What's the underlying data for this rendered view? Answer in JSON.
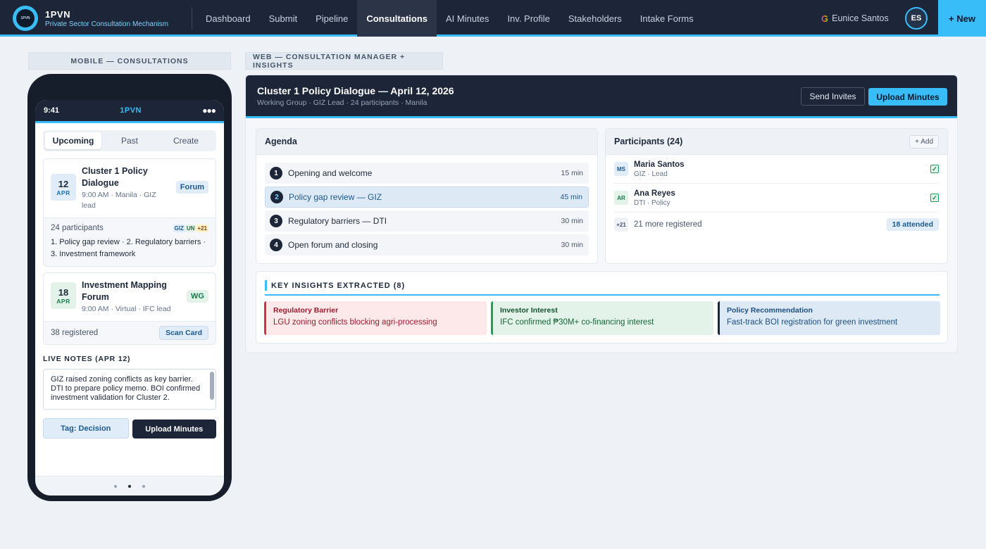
{
  "nav": {
    "logo_text": "1PVN",
    "brand_name": "1PVN",
    "brand_sub": "Private Sector Consultation Mechanism",
    "items": [
      {
        "label": "Dashboard"
      },
      {
        "label": "Submit"
      },
      {
        "label": "Pipeline"
      },
      {
        "label": "Consultations",
        "active": true
      },
      {
        "label": "AI Minutes"
      },
      {
        "label": "Inv. Profile"
      },
      {
        "label": "Stakeholders"
      },
      {
        "label": "Intake Forms"
      }
    ],
    "google_glyph": "G",
    "user_name": "Eunice Santos",
    "avatar_initials": "ES",
    "new_label": "+ New",
    "accent": "#38bdf8"
  },
  "mobile": {
    "section_label": "MOBILE — CONSULTATIONS",
    "status": {
      "time": "9:41",
      "app": "1PVN",
      "signal": "●●●"
    },
    "tabs": [
      "Upcoming",
      "Past",
      "Create"
    ],
    "events": [
      {
        "day": "12",
        "month": "APR",
        "title": "Cluster 1 Policy Dialogue",
        "meta": "9:00 AM · Manila · GIZ lead",
        "tag": "Forum",
        "count": "24 participants",
        "orgs": [
          "GIZ",
          "UN",
          "+21"
        ],
        "agenda": "1. Policy gap review · 2. Regulatory barriers · 3. Investment framework"
      },
      {
        "day": "18",
        "month": "APR",
        "title": "Investment Mapping Forum",
        "meta": "9:00 AM · Virtual · IFC lead",
        "tag": "WG",
        "count": "38 registered",
        "action": "Scan Card"
      }
    ],
    "notes_heading": "LIVE NOTES (APR 12)",
    "notes_text": "GIZ raised zoning conflicts as key barrier. DTI to prepare policy memo. BOI confirmed investment validation for Cluster 2.",
    "tag_button": "Tag: Decision",
    "upload_button": "Upload Minutes"
  },
  "web": {
    "section_label": "WEB — CONSULTATION MANAGER + INSIGHTS",
    "title": "Cluster 1 Policy Dialogue — April 12, 2026",
    "subtitle": "Working Group · GIZ Lead · 24 participants · Manila",
    "send_invites": "Send Invites",
    "upload_minutes": "Upload Minutes",
    "agenda": {
      "title": "Agenda",
      "items": [
        {
          "num": "1",
          "label": "Opening and welcome",
          "duration": "15 min"
        },
        {
          "num": "2",
          "label": "Policy gap review — GIZ",
          "duration": "45 min",
          "active": true
        },
        {
          "num": "3",
          "label": "Regulatory barriers — DTI",
          "duration": "30 min"
        },
        {
          "num": "4",
          "label": "Open forum and closing",
          "duration": "30 min"
        }
      ]
    },
    "participants": {
      "title": "Participants (24)",
      "add_label": "+ Add",
      "list": [
        {
          "initials": "MS",
          "name": "Maria Santos",
          "role": "GIZ · Lead",
          "checked": true
        },
        {
          "initials": "AR",
          "name": "Ana Reyes",
          "role": "DTI · Policy",
          "checked": true
        }
      ],
      "more_badge": "+21",
      "more_text": "21 more registered",
      "attended": "18 attended"
    },
    "insights": {
      "title": "KEY INSIGHTS EXTRACTED (8)",
      "items": [
        {
          "category": "Regulatory Barrier",
          "text": "LGU zoning conflicts blocking agri-processing",
          "color": "#d3334a"
        },
        {
          "category": "Investor Interest",
          "text": "IFC confirmed ₱30M+ co-financing interest",
          "color": "#22a05a"
        },
        {
          "category": "Policy Recommendation",
          "text": "Fast-track BOI registration for green investment",
          "color": "#1c2638"
        }
      ]
    }
  }
}
